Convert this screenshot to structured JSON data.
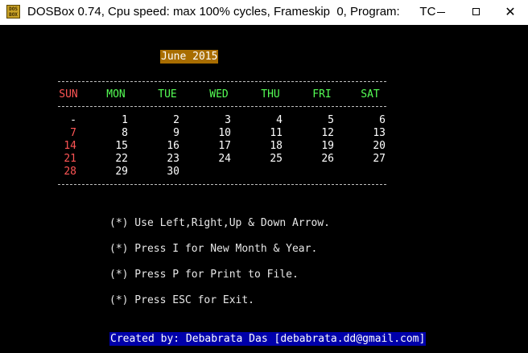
{
  "window": {
    "title": "DOSBox 0.74, Cpu speed: max 100% cycles, Frameskip  0, Program:      TC",
    "icon_text": "DOS BOX",
    "icon": "dosbox-icon",
    "minimize": "minimize-icon",
    "maximize": "maximize-icon",
    "close": "close-icon",
    "close_glyph": "✕"
  },
  "calendar": {
    "heading": "June 2015",
    "days": [
      {
        "label": "SUN",
        "color": "#ff5555"
      },
      {
        "label": "MON",
        "color": "#55ff55"
      },
      {
        "label": "TUE",
        "color": "#55ff55"
      },
      {
        "label": "WED",
        "color": "#55ff55"
      },
      {
        "label": "THU",
        "color": "#55ff55"
      },
      {
        "label": "FRI",
        "color": "#55ff55"
      },
      {
        "label": "SAT",
        "color": "#55ff55"
      }
    ],
    "weeks": [
      [
        "-",
        "1",
        "2",
        "3",
        "4",
        "5",
        "6"
      ],
      [
        "7",
        "8",
        "9",
        "10",
        "11",
        "12",
        "13"
      ],
      [
        "14",
        "15",
        "16",
        "17",
        "18",
        "19",
        "20"
      ],
      [
        "21",
        "22",
        "23",
        "24",
        "25",
        "26",
        "27"
      ],
      [
        "28",
        "29",
        "30",
        "",
        "",
        "",
        ""
      ]
    ],
    "sunday_color": "#ff5555",
    "day_color": "#ffffff"
  },
  "instructions": [
    "(*) Use Left,Right,Up & Down Arrow.",
    "(*) Press I for New Month & Year.",
    "(*) Press P for Print to File.",
    "(*) Press ESC for Exit."
  ],
  "footer": "Created by: Debabrata Das [debabrata.dd@gmail.com]"
}
